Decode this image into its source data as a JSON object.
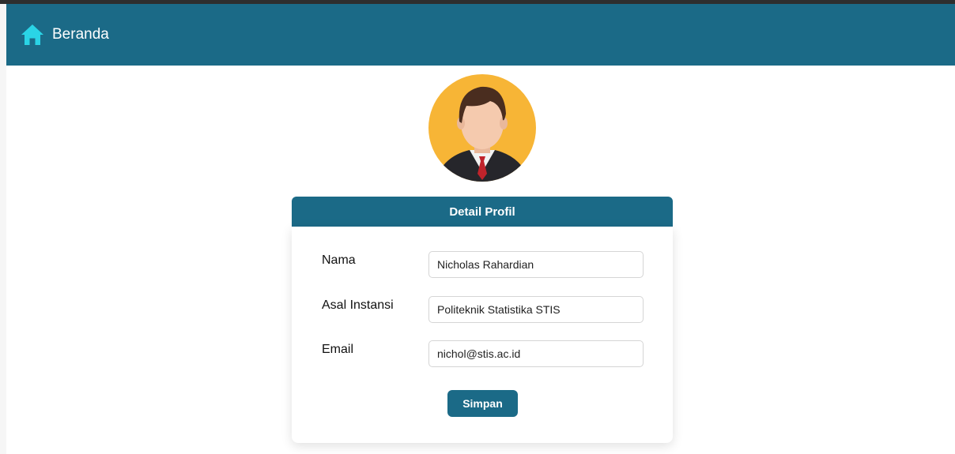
{
  "navbar": {
    "home_icon": "home-icon",
    "home_label": "Beranda"
  },
  "avatar": {
    "icon": "user-avatar-man-in-suit"
  },
  "profile": {
    "header_title": "Detail Profil",
    "fields": [
      {
        "label": "Nama",
        "value": "Nicholas Rahardian"
      },
      {
        "label": "Asal Instansi",
        "value": "Politeknik Statistika STIS"
      },
      {
        "label": "Email",
        "value": "nichol@stis.ac.id"
      }
    ],
    "save_label": "Simpan"
  },
  "colors": {
    "primary": "#1b6a87",
    "home_icon": "#2ad4e6",
    "avatar_bg": "#f7b536"
  }
}
